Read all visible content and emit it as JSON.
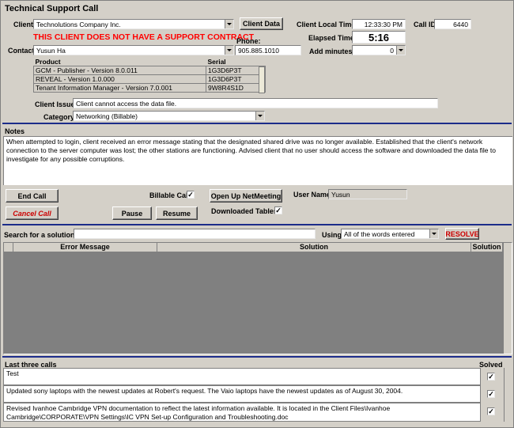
{
  "window": {
    "title": "Technical Support Call"
  },
  "client": {
    "label": "Client",
    "value": "Technolutions Company Inc.",
    "data_button": "Client Data",
    "warning": "THIS CLIENT DOES NOT HAVE A SUPPORT CONTRACT"
  },
  "contact": {
    "label": "Contact",
    "value": "Yusun Ha"
  },
  "phone": {
    "label": "Phone:",
    "value": "905.885.1010"
  },
  "time": {
    "local_label": "Client Local Time",
    "local_value": "12:33:30 PM",
    "elapsed_label": "Elapsed Time",
    "elapsed_value": "5:16",
    "add_minutes_label": "Add minutes",
    "add_minutes_value": "0"
  },
  "call_id": {
    "label": "Call ID",
    "value": "6440"
  },
  "products": {
    "headers": [
      "Product",
      "Serial"
    ],
    "rows": [
      {
        "product": "GCM - Publisher - Version 8.0.011",
        "serial": "1G3D6P3T"
      },
      {
        "product": "REVEAL - Version 1.0.000",
        "serial": "1G3D6P3T"
      },
      {
        "product": "Tenant Information Manager - Version 7.0.001",
        "serial": "9W8R4S1D"
      }
    ]
  },
  "issue": {
    "label": "Client Issue",
    "value": "Client cannot access the data file."
  },
  "category": {
    "label": "Category",
    "value": "Networking (Billable)"
  },
  "notes": {
    "label": "Notes",
    "text": "When attempted to login, client received an error message stating that the designated shared drive was no longer available.  Established that the client's network connection to the server computer was lost; the other stations are functioning.  Advised client that no user should access the software and downloaded the data file to investigate for any possible corruptions."
  },
  "actions": {
    "end_call": "End Call",
    "cancel_call": "Cancel Call",
    "billable_label": "Billable Call",
    "billable_checked": "✓",
    "netmeeting": "Open Up NetMeeting",
    "pause": "Pause",
    "resume": "Resume",
    "downloaded_label": "Downloaded Tables",
    "downloaded_checked": "✓",
    "user_label": "User Name",
    "user_value": "Yusun"
  },
  "search": {
    "label": "Search for a solution..",
    "value": "",
    "using_label": "Using",
    "using_value": "All of the words entered",
    "resolve": "RESOLVE"
  },
  "solutions": {
    "headers": [
      "Error Message",
      "Solution",
      "Solution"
    ]
  },
  "last_calls": {
    "label": "Last three calls",
    "solved_label": "Solved",
    "rows": [
      {
        "text": "Test",
        "solved": "✓"
      },
      {
        "text": "Updated sony laptops with the newest updates at Robert's request. The Vaio laptops have the newest updates as of August 30, 2004.",
        "solved": "✓"
      },
      {
        "text": "Revised Ivanhoe Cambridge VPN documentation to reflect the latest information available. It is located in the Client Files\\Ivanhoe Cambridge\\CORPORATE\\VPN Settings\\IC VPN Set-up Configuration and Troubleshooting.doc",
        "solved": "✓"
      }
    ]
  },
  "colors": {
    "separator": "#1c2c8a",
    "warning": "#ff0000",
    "grid_bg": "#808080"
  }
}
